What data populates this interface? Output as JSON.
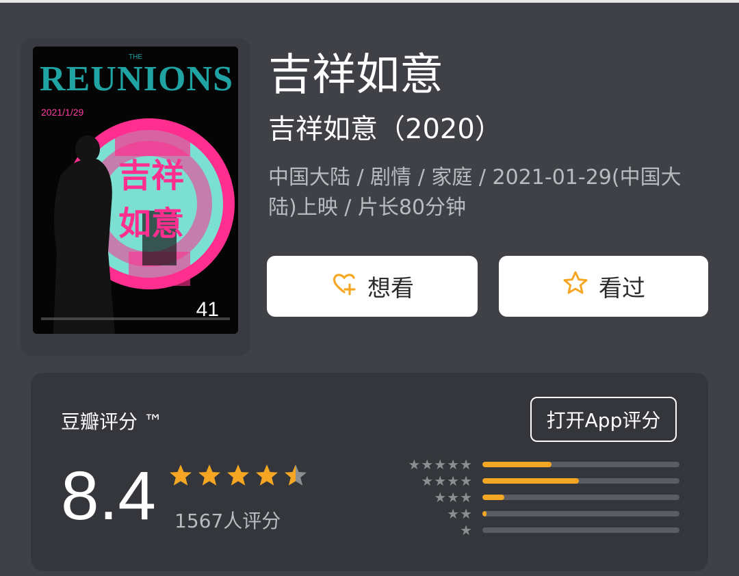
{
  "movie": {
    "title": "吉祥如意",
    "subtitle": "吉祥如意（2020）",
    "meta": "中国大陆 / 剧情 / 家庭 / 2021-01-29(中国大陆)上映 / 片长80分钟"
  },
  "poster": {
    "the_label": "THE",
    "title_letters": [
      "R",
      "E",
      "U",
      "N",
      "I",
      "O",
      "N",
      "S"
    ],
    "date_text": "2021/1/29",
    "badge_number": "41"
  },
  "actions": {
    "want_label": "想看",
    "want_icon": "heart-plus-icon",
    "seen_label": "看过",
    "seen_icon": "star-outline-icon",
    "accent_color": "#f5a623"
  },
  "rating": {
    "label": "豆瓣评分 ™",
    "open_app_label": "打开App评分",
    "score": "8.4",
    "stars_value": 4.5,
    "count_text": "1567人评分",
    "distribution": [
      {
        "stars": 5,
        "fraction": 0.35
      },
      {
        "stars": 4,
        "fraction": 0.49
      },
      {
        "stars": 3,
        "fraction": 0.11
      },
      {
        "stars": 2,
        "fraction": 0.02
      },
      {
        "stars": 1,
        "fraction": 0.0
      }
    ]
  }
}
